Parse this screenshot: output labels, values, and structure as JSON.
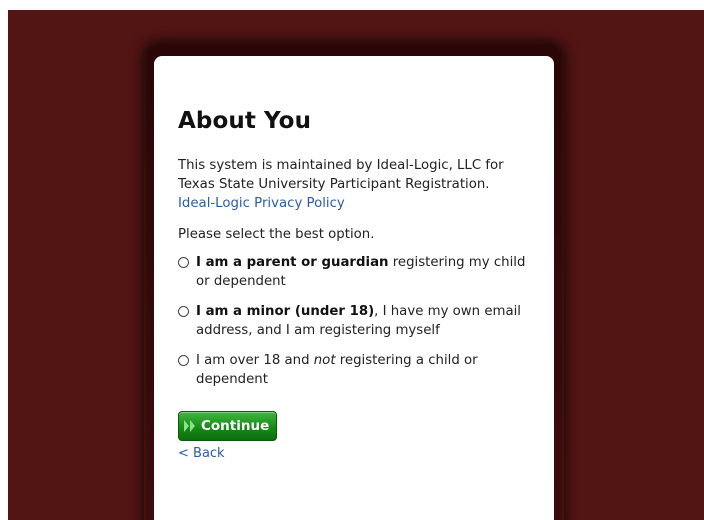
{
  "page": {
    "title": "About You",
    "intro_text": "This system is maintained by Ideal-Logic, LLC for Texas State University Participant Registration.",
    "privacy_link": "Ideal-Logic Privacy Policy",
    "prompt": "Please select the best option."
  },
  "options": [
    {
      "bold": "I am a parent or guardian",
      "rest": " registering my child or dependent",
      "selected": false
    },
    {
      "bold": "I am a minor (under 18)",
      "rest": ", I have my own email address, and I am registering myself",
      "selected": false
    },
    {
      "before": "I am over 18 and ",
      "italic": "not",
      "after": " registering a child or dependent",
      "selected": false
    }
  ],
  "actions": {
    "continue_label": "Continue",
    "back_label": "< Back"
  },
  "colors": {
    "background": "#531414",
    "link": "#2a5d9f",
    "button": "#178a17"
  },
  "icons": {
    "continue": "double-chevron-right-icon"
  }
}
